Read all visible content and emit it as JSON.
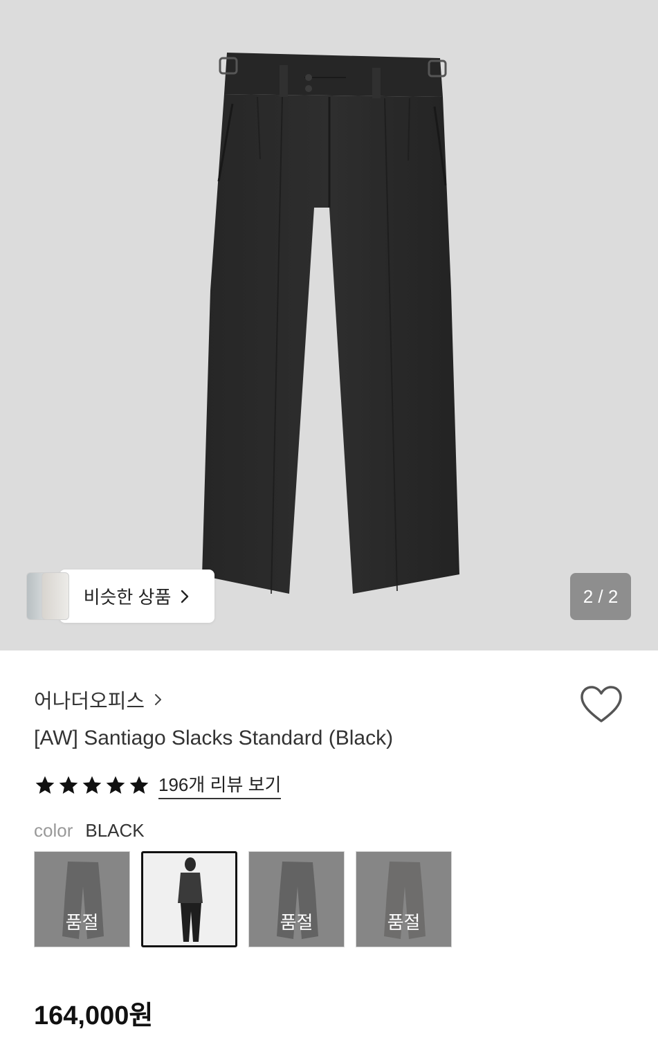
{
  "gallery": {
    "similar_button_label": "비슷한 상품",
    "page_counter": "2 / 2"
  },
  "product": {
    "brand": "어나더오피스",
    "title": "[AW] Santiago Slacks Standard (Black)",
    "rating_stars": 5,
    "reviews_link": "196개 리뷰 보기",
    "color_label": "color",
    "color_value": "BLACK",
    "price": "164,000원"
  },
  "swatches": [
    {
      "status": "품절",
      "selected": false
    },
    {
      "status": "",
      "selected": true
    },
    {
      "status": "품절",
      "selected": false
    },
    {
      "status": "품절",
      "selected": false
    }
  ],
  "colors": {
    "hero_background": "#dcdcdc",
    "counter_background": "#8e8e8e"
  }
}
